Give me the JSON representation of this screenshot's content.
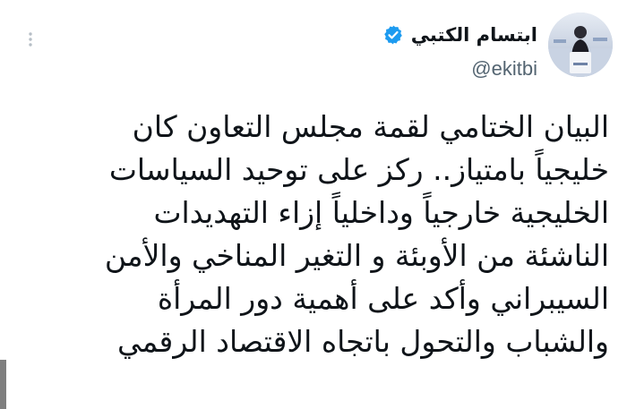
{
  "author": {
    "display_name": "ابتسام الكتبي",
    "handle": "@ekitbi",
    "verified": true,
    "avatar_icon": "speaker-at-podium-photo"
  },
  "menu": {
    "icon": "vertical-dots-icon"
  },
  "tweet": {
    "lines": [
      "البيان الختامي لقمة مجلس التعاون كان",
      "خليجياً  بامتياز.. ركز على توحيد السياسات",
      "الخليجية خارجياً وداخلياً إزاء التهديدات",
      "الناشئة من الأوبئة و التغير المناخي والأمن",
      "السيبراني وأكد على أهمية دور المرأة",
      "والشباب والتحول باتجاه الاقتصاد الرقمي"
    ]
  },
  "colors": {
    "text_primary": "#0f1419",
    "text_secondary": "#536471",
    "verified_badge": "#1d9bf0",
    "background": "#ffffff"
  }
}
